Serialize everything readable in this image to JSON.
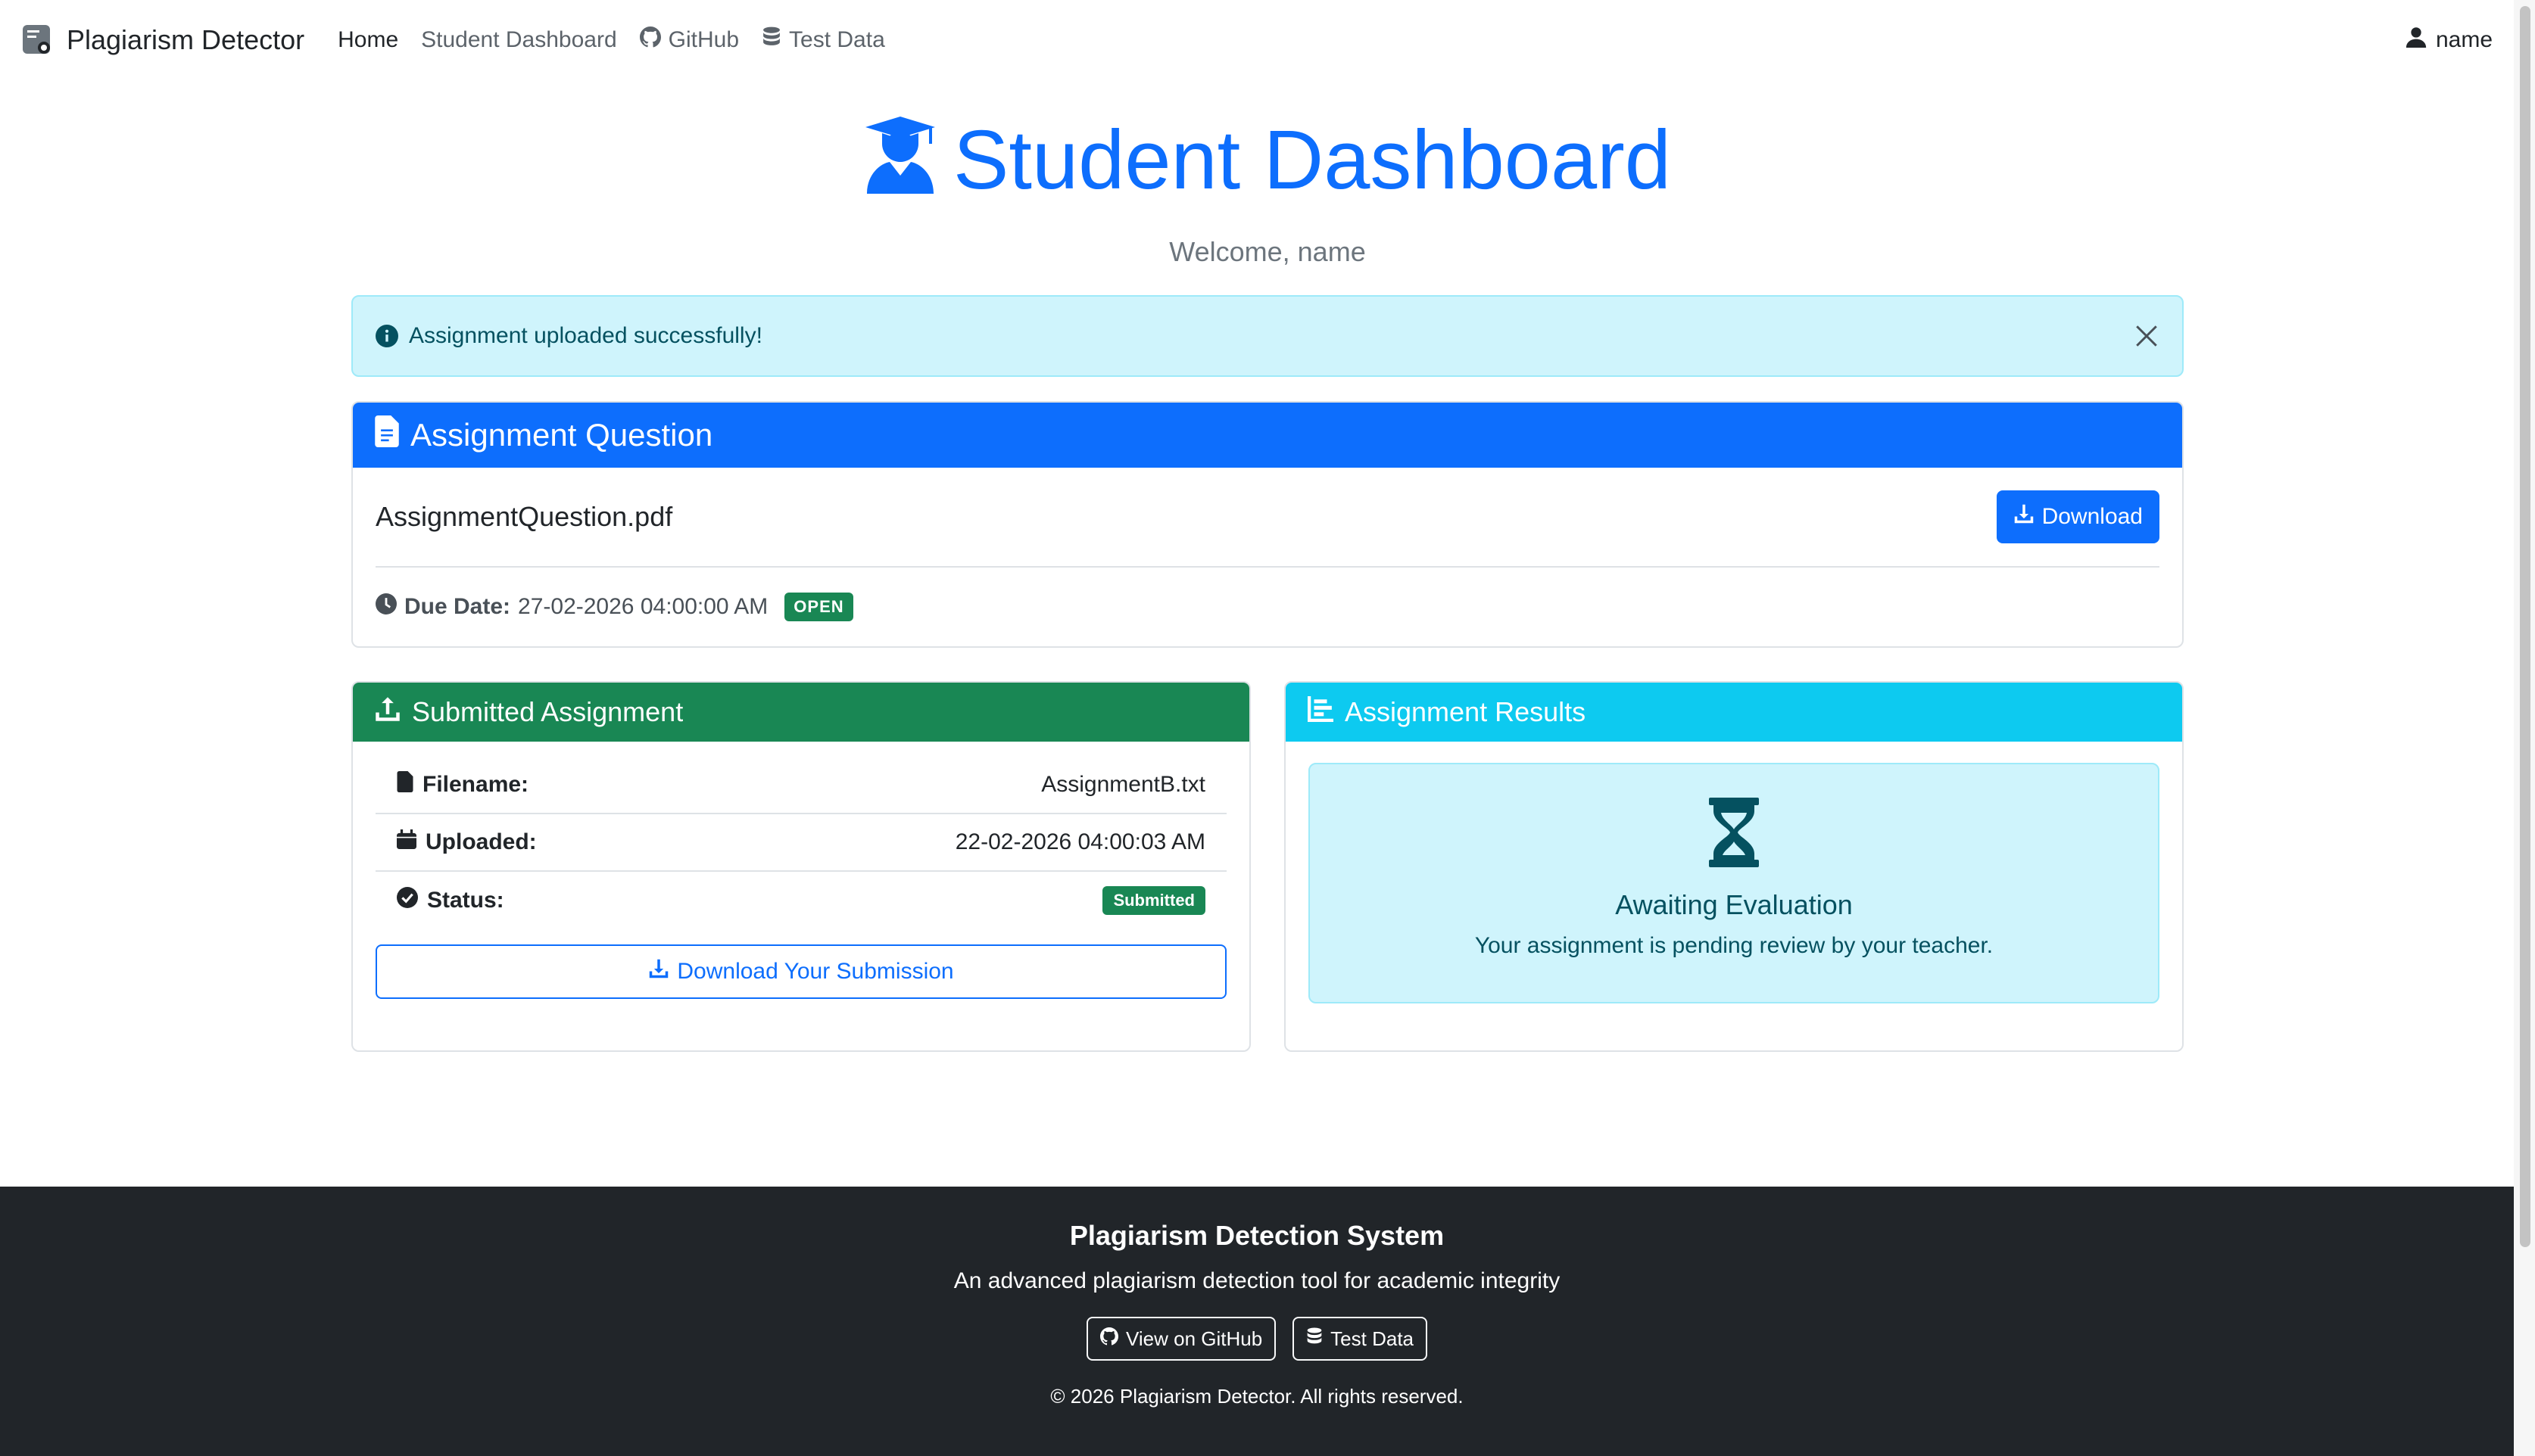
{
  "navbar": {
    "brand": "Plagiarism Detector",
    "links": [
      "Home",
      "Student Dashboard",
      "GitHub",
      "Test Data"
    ],
    "user": "name"
  },
  "header": {
    "title": "Student Dashboard",
    "subtitle": "Welcome, name"
  },
  "alert": {
    "message": "Assignment uploaded successfully!"
  },
  "question": {
    "title": "Assignment Question",
    "filename": "AssignmentQuestion.pdf",
    "download_label": "Download",
    "due_label": "Due Date:",
    "due_value": "27-02-2026 04:00:00 AM",
    "status_badge": "OPEN"
  },
  "submitted": {
    "title": "Submitted Assignment",
    "rows": [
      {
        "label": "Filename:",
        "value": "AssignmentB.txt"
      },
      {
        "label": "Uploaded:",
        "value": "22-02-2026 04:00:03 AM"
      },
      {
        "label": "Status:",
        "value": "Submitted"
      }
    ],
    "download_label": "Download Your Submission"
  },
  "results": {
    "title": "Assignment Results",
    "status_title": "Awaiting Evaluation",
    "status_text": "Your assignment is pending review by your teacher."
  },
  "footer": {
    "title": "Plagiarism Detection System",
    "description": "An advanced plagiarism detection tool for academic integrity",
    "github_label": "View on GitHub",
    "testdata_label": "Test Data",
    "copyright": "© 2026 Plagiarism Detector. All rights reserved."
  },
  "colors": {
    "primary": "#0d6efd",
    "success": "#198754",
    "info": "#0dcaf0",
    "info_bg": "#cff4fc",
    "dark": "#212529"
  }
}
